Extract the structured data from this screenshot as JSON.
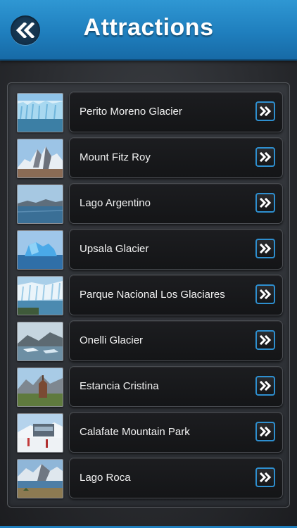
{
  "header": {
    "title": "Attractions",
    "back_icon": "double-chevron-left-icon"
  },
  "accent_color": "#1f7fbe",
  "items": [
    {
      "label": "Perito Moreno Glacier",
      "thumb": "glacier"
    },
    {
      "label": "Mount Fitz Roy",
      "thumb": "mountain"
    },
    {
      "label": "Lago Argentino",
      "thumb": "lake"
    },
    {
      "label": "Upsala Glacier",
      "thumb": "iceberg"
    },
    {
      "label": "Parque Nacional Los Glaciares",
      "thumb": "glacier"
    },
    {
      "label": "Onelli Glacier",
      "thumb": "iceberg"
    },
    {
      "label": "Estancia Cristina",
      "thumb": "estancia"
    },
    {
      "label": "Calafate Mountain Park",
      "thumb": "park"
    },
    {
      "label": "Lago Roca",
      "thumb": "mountain"
    }
  ]
}
